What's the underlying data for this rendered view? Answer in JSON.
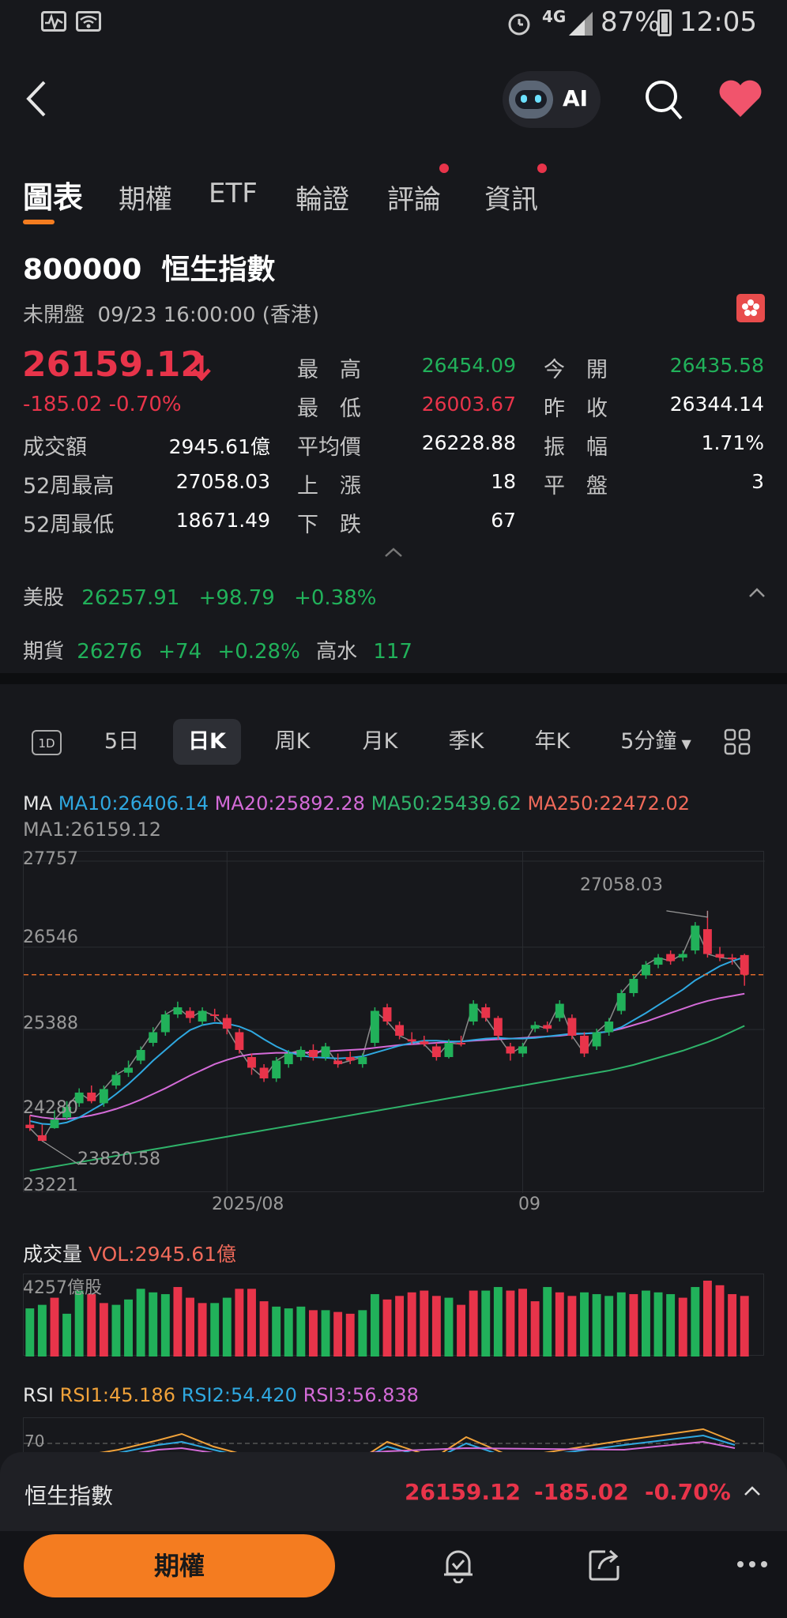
{
  "status_bar": {
    "battery": "87%",
    "time": "12:05",
    "signal": "4G"
  },
  "header": {
    "ai_label": "AI"
  },
  "tabs": [
    {
      "label": "圖表",
      "active": true
    },
    {
      "label": "期權"
    },
    {
      "label": "ETF"
    },
    {
      "label": "輪證"
    },
    {
      "label": "評論",
      "dot": true
    },
    {
      "label": "資訊",
      "dot": true
    }
  ],
  "stock": {
    "code": "800000",
    "name": "恒生指數",
    "status": "未開盤",
    "datetime": "09/23 16:00:00 (香港)",
    "price": "26159.12",
    "change": "-185.02",
    "change_pct": "-0.70%"
  },
  "stats": {
    "high_label": "最　高",
    "high": "26454.09",
    "open_label": "今　開",
    "open": "26435.58",
    "low_label": "最　低",
    "low": "26003.67",
    "prev_label": "昨　收",
    "prev": "26344.14",
    "turnover_label": "成交額",
    "turnover": "2945.61億",
    "avg_label": "平均價",
    "avg": "26228.88",
    "amp_label": "振　幅",
    "amp": "1.71%",
    "w52h_label": "52周最高",
    "w52h": "27058.03",
    "up_label": "上　漲",
    "up": "18",
    "flat_label": "平　盤",
    "flat": "3",
    "w52l_label": "52周最低",
    "w52l": "18671.49",
    "down_label": "下　跌",
    "down": "67"
  },
  "us": {
    "label": "美股",
    "value": "26257.91",
    "change": "+98.79",
    "pct": "+0.38%"
  },
  "futures": {
    "label": "期貨",
    "value": "26276",
    "change": "+74",
    "pct": "+0.28%",
    "premium_label": "高水",
    "premium": "117"
  },
  "periods": [
    {
      "label": "1D"
    },
    {
      "label": "5日"
    },
    {
      "label": "日K",
      "active": true
    },
    {
      "label": "周K"
    },
    {
      "label": "月K"
    },
    {
      "label": "季K"
    },
    {
      "label": "年K"
    },
    {
      "label": "5分鐘"
    }
  ],
  "ma": {
    "label": "MA",
    "ma10": "MA10:26406.14",
    "ma20": "MA20:25892.28",
    "ma50": "MA50:25439.62",
    "ma250": "MA250:22472.02",
    "ma1": "MA1:26159.12",
    "c10": "#2fa8e0",
    "c20": "#d46bd8",
    "c50": "#2fb36a",
    "c250": "#f06a5a"
  },
  "chart_data": {
    "type": "candlestick",
    "y_ticks": [
      "27757",
      "26546",
      "25388",
      "24280",
      "23221"
    ],
    "ylim": [
      23221,
      27757
    ],
    "x_ticks": [
      "2025/08",
      "09"
    ],
    "annotations": {
      "high": "27058.03",
      "low": "23820.58"
    },
    "last_close": 26159.12,
    "candles": [
      [
        24048,
        24000,
        24180,
        23960
      ],
      [
        23900,
        23820.58,
        24050,
        23820.58
      ],
      [
        24000,
        24120,
        24250,
        23990
      ],
      [
        24150,
        24300,
        24380,
        24120
      ],
      [
        24350,
        24500,
        24560,
        24300
      ],
      [
        24500,
        24380,
        24600,
        24350
      ],
      [
        24350,
        24550,
        24600,
        24300
      ],
      [
        24600,
        24750,
        24800,
        24550
      ],
      [
        24780,
        24850,
        24950,
        24720
      ],
      [
        24950,
        25100,
        25150,
        24900
      ],
      [
        25200,
        25350,
        25420,
        25150
      ],
      [
        25350,
        25600,
        25650,
        25300
      ],
      [
        25600,
        25700,
        25780,
        25550
      ],
      [
        25650,
        25550,
        25700,
        25480
      ],
      [
        25500,
        25650,
        25700,
        25450
      ],
      [
        25600,
        25580,
        25680,
        25500
      ],
      [
        25550,
        25400,
        25600,
        25320
      ],
      [
        25350,
        25100,
        25400,
        25050
      ],
      [
        25000,
        24850,
        25050,
        24750
      ],
      [
        24850,
        24700,
        24900,
        24650
      ],
      [
        24700,
        24950,
        25000,
        24650
      ],
      [
        24900,
        25050,
        25100,
        24850
      ],
      [
        25000,
        25100,
        25150,
        24950
      ],
      [
        25100,
        25000,
        25180,
        24950
      ],
      [
        25000,
        25150,
        25200,
        24950
      ],
      [
        24950,
        24900,
        25050,
        24850
      ],
      [
        25000,
        24950,
        25080,
        24900
      ],
      [
        24900,
        25000,
        25050,
        24850
      ],
      [
        25200,
        25650,
        25700,
        25150
      ],
      [
        25700,
        25500,
        25750,
        25450
      ],
      [
        25450,
        25300,
        25500,
        25250
      ],
      [
        25250,
        25220,
        25350,
        25180
      ],
      [
        25220,
        25180,
        25300,
        25150
      ],
      [
        25150,
        25000,
        25200,
        24950
      ],
      [
        25000,
        25200,
        25250,
        24980
      ],
      [
        25200,
        25180,
        25300,
        25150
      ],
      [
        25500,
        25750,
        25800,
        25450
      ],
      [
        25700,
        25550,
        25750,
        25500
      ],
      [
        25550,
        25300,
        25580,
        25250
      ],
      [
        25150,
        25050,
        25200,
        24950
      ],
      [
        25050,
        25150,
        25200,
        25000
      ],
      [
        25400,
        25450,
        25500,
        25350
      ],
      [
        25450,
        25400,
        25500,
        25350
      ],
      [
        25550,
        25750,
        25800,
        25500
      ],
      [
        25550,
        25300,
        25600,
        25250
      ],
      [
        25300,
        25050,
        25350,
        25000
      ],
      [
        25150,
        25350,
        25400,
        25100
      ],
      [
        25350,
        25500,
        25550,
        25300
      ],
      [
        25650,
        25900,
        25950,
        25600
      ],
      [
        25900,
        26100,
        26150,
        25850
      ],
      [
        26150,
        26300,
        26350,
        26100
      ],
      [
        26300,
        26400,
        26450,
        26250
      ],
      [
        26450,
        26350,
        26500,
        26300
      ],
      [
        26400,
        26450,
        26500,
        26350
      ],
      [
        26500,
        26850,
        26900,
        26450
      ],
      [
        26800,
        26450,
        27058.03,
        26400
      ],
      [
        26450,
        26400,
        26550,
        26350
      ],
      [
        26400,
        26380,
        26450,
        26300
      ],
      [
        26435.58,
        26159.12,
        26454.09,
        26003.67
      ]
    ],
    "ma10": [
      24100,
      24060,
      24050,
      24080,
      24150,
      24250,
      24350,
      24480,
      24620,
      24780,
      24950,
      25100,
      25250,
      25380,
      25450,
      25480,
      25470,
      25430,
      25360,
      25250,
      25150,
      25070,
      25020,
      25000,
      24990,
      24980,
      24990,
      25010,
      25060,
      25110,
      25160,
      25200,
      25230,
      25230,
      25220,
      25220,
      25240,
      25260,
      25270,
      25260,
      25260,
      25270,
      25290,
      25310,
      25330,
      25330,
      25340,
      25360,
      25420,
      25520,
      25620,
      25730,
      25840,
      25950,
      26080,
      26180,
      26280,
      26350,
      26406.14
    ],
    "ma20": [
      24180,
      24150,
      24130,
      24130,
      24150,
      24180,
      24220,
      24270,
      24330,
      24400,
      24480,
      24560,
      24650,
      24740,
      24820,
      24900,
      24960,
      25010,
      25040,
      25050,
      25060,
      25060,
      25060,
      25070,
      25080,
      25090,
      25100,
      25110,
      25130,
      25150,
      25170,
      25180,
      25190,
      25200,
      25210,
      25220,
      25230,
      25240,
      25250,
      25260,
      25270,
      25280,
      25290,
      25300,
      25320,
      25330,
      25340,
      25360,
      25400,
      25450,
      25500,
      25560,
      25620,
      25680,
      25740,
      25790,
      25830,
      25860,
      25892.28
    ],
    "ma50": [
      23400,
      23430,
      23460,
      23490,
      23520,
      23550,
      23580,
      23610,
      23640,
      23670,
      23700,
      23730,
      23760,
      23790,
      23820,
      23850,
      23880,
      23910,
      23940,
      23970,
      24000,
      24030,
      24060,
      24090,
      24120,
      24150,
      24180,
      24210,
      24240,
      24270,
      24300,
      24330,
      24360,
      24390,
      24420,
      24450,
      24480,
      24510,
      24540,
      24570,
      24600,
      24630,
      24660,
      24690,
      24720,
      24750,
      24780,
      24810,
      24850,
      24890,
      24940,
      24990,
      25040,
      25090,
      25150,
      25210,
      25280,
      25360,
      25439.62
    ]
  },
  "volume": {
    "label": "成交量",
    "vol_text": "VOL:2945.61億",
    "max_label": "4257億股",
    "max": 4257,
    "bars": [
      [
        2700,
        "g"
      ],
      [
        2900,
        "g"
      ],
      [
        3300,
        "r"
      ],
      [
        2400,
        "g"
      ],
      [
        3700,
        "g"
      ],
      [
        3500,
        "r"
      ],
      [
        3000,
        "r"
      ],
      [
        2900,
        "g"
      ],
      [
        3200,
        "g"
      ],
      [
        3800,
        "g"
      ],
      [
        3600,
        "g"
      ],
      [
        3500,
        "g"
      ],
      [
        3900,
        "r"
      ],
      [
        3300,
        "r"
      ],
      [
        3000,
        "r"
      ],
      [
        3000,
        "g"
      ],
      [
        3300,
        "g"
      ],
      [
        3800,
        "r"
      ],
      [
        3800,
        "r"
      ],
      [
        3100,
        "r"
      ],
      [
        2800,
        "g"
      ],
      [
        2700,
        "g"
      ],
      [
        2800,
        "g"
      ],
      [
        2600,
        "r"
      ],
      [
        2600,
        "g"
      ],
      [
        2500,
        "r"
      ],
      [
        2400,
        "r"
      ],
      [
        2600,
        "g"
      ],
      [
        3500,
        "g"
      ],
      [
        3200,
        "r"
      ],
      [
        3400,
        "r"
      ],
      [
        3600,
        "r"
      ],
      [
        3700,
        "r"
      ],
      [
        3400,
        "r"
      ],
      [
        3300,
        "g"
      ],
      [
        2900,
        "r"
      ],
      [
        3700,
        "r"
      ],
      [
        3700,
        "g"
      ],
      [
        3900,
        "g"
      ],
      [
        3700,
        "r"
      ],
      [
        3800,
        "r"
      ],
      [
        3100,
        "r"
      ],
      [
        3900,
        "g"
      ],
      [
        3600,
        "r"
      ],
      [
        3400,
        "r"
      ],
      [
        3600,
        "g"
      ],
      [
        3500,
        "g"
      ],
      [
        3400,
        "g"
      ],
      [
        3600,
        "g"
      ],
      [
        3500,
        "r"
      ],
      [
        3700,
        "g"
      ],
      [
        3600,
        "g"
      ],
      [
        3500,
        "g"
      ],
      [
        3300,
        "r"
      ],
      [
        3900,
        "g"
      ],
      [
        4257,
        "r"
      ],
      [
        4000,
        "r"
      ],
      [
        3500,
        "r"
      ],
      [
        3400,
        "r"
      ]
    ]
  },
  "rsi": {
    "label": "RSI",
    "rsi1": "RSI1:45.186",
    "rsi2": "RSI2:54.420",
    "rsi3": "RSI3:56.838",
    "tick": "70"
  },
  "bottom": {
    "name": "恒生指數",
    "price": "26159.12",
    "change": "-185.02",
    "pct": "-0.70%",
    "options_btn": "期權"
  }
}
